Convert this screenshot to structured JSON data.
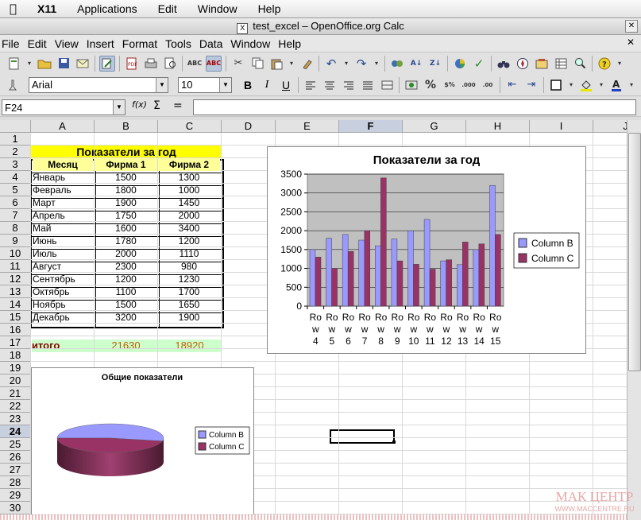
{
  "macmenu": {
    "app": "X11",
    "items": [
      "Applications",
      "Edit",
      "Window",
      "Help"
    ]
  },
  "window": {
    "title": "test_excel – OpenOffice.org Calc",
    "icon": "X"
  },
  "menu": [
    "File",
    "Edit",
    "View",
    "Insert",
    "Format",
    "Tools",
    "Data",
    "Window",
    "Help"
  ],
  "format": {
    "font": "Arial",
    "size": "10",
    "bold": "B",
    "italic": "I",
    "underline": "U"
  },
  "formula": {
    "namebox": "F24",
    "fx": "f(x)",
    "sigma": "Σ",
    "eq": "=",
    "value": ""
  },
  "columns": [
    "A",
    "B",
    "C",
    "D",
    "E",
    "F",
    "G",
    "H",
    "I",
    "J"
  ],
  "selected_column": "F",
  "selected_row": "24",
  "rows": [
    "1",
    "2",
    "3",
    "4",
    "5",
    "6",
    "7",
    "8",
    "9",
    "10",
    "11",
    "12",
    "13",
    "14",
    "15",
    "16",
    "17",
    "18",
    "19",
    "20",
    "21",
    "22",
    "23",
    "24",
    "25",
    "26",
    "27",
    "28",
    "29",
    "30"
  ],
  "table": {
    "title": "Показатели за год",
    "headers": [
      "Месяц",
      "Фирма 1",
      "Фирма 2"
    ],
    "rows": [
      [
        "Январь",
        "1500",
        "1300"
      ],
      [
        "Февраль",
        "1800",
        "1000"
      ],
      [
        "Март",
        "1900",
        "1450"
      ],
      [
        "Апрель",
        "1750",
        "2000"
      ],
      [
        "Май",
        "1600",
        "3400"
      ],
      [
        "Июнь",
        "1780",
        "1200"
      ],
      [
        "Июль",
        "2000",
        "1110"
      ],
      [
        "Август",
        "2300",
        "980"
      ],
      [
        "Сентябрь",
        "1200",
        "1230"
      ],
      [
        "Октябрь",
        "1100",
        "1700"
      ],
      [
        "Ноябрь",
        "1500",
        "1650"
      ],
      [
        "Декабрь",
        "3200",
        "1900"
      ]
    ],
    "total_label": "итого",
    "total_b": "21630",
    "total_c": "18920"
  },
  "chart_data": [
    {
      "type": "bar",
      "title": "Показатели за год",
      "categories": [
        "Ro w 4",
        "Ro w 5",
        "Ro w 6",
        "Ro w 7",
        "Ro w 8",
        "Ro w 9",
        "Ro w 10",
        "Ro w 11",
        "Ro w 12",
        "Ro w 13",
        "Ro w 14",
        "Ro w 15"
      ],
      "series": [
        {
          "name": "Column B",
          "values": [
            1500,
            1800,
            1900,
            1750,
            1600,
            1780,
            2000,
            2300,
            1200,
            1100,
            1500,
            3200
          ],
          "color": "#9999ff"
        },
        {
          "name": "Column C",
          "values": [
            1300,
            1000,
            1450,
            2000,
            3400,
            1200,
            1110,
            980,
            1230,
            1700,
            1650,
            1900
          ],
          "color": "#993366"
        }
      ],
      "ylim": [
        0,
        3500
      ],
      "yticks": [
        "0",
        "500",
        "1000",
        "1500",
        "2000",
        "2500",
        "3000",
        "3500"
      ],
      "grid": true,
      "legend": "right"
    },
    {
      "type": "pie",
      "title": "Общие показатели",
      "labels": [
        "Column B",
        "Column C"
      ],
      "values": [
        21630,
        18920
      ],
      "colors": [
        "#9999ff",
        "#993366"
      ],
      "legend": "right"
    }
  ],
  "watermark": {
    "brand": "МАК ЦЕНТР",
    "url": "WWW.MACCENTRE.RU"
  }
}
